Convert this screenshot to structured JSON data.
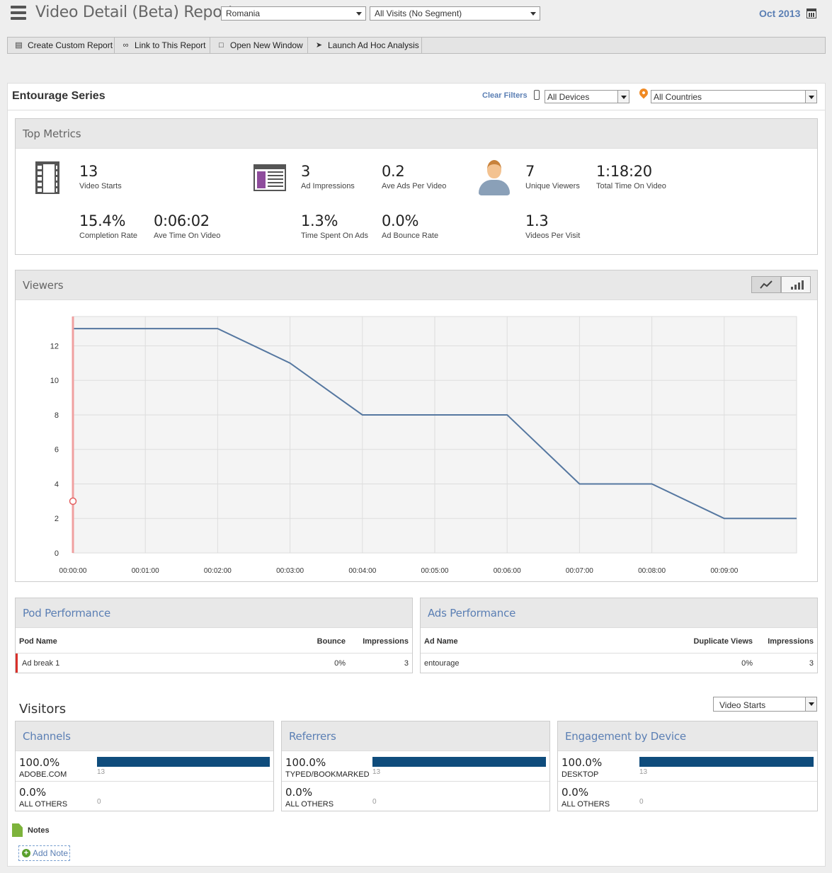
{
  "header": {
    "title": "Video Detail (Beta) Report",
    "region_select": "Romania",
    "segment_select": "All Visits (No Segment)",
    "date": "Oct 2013"
  },
  "toolbar": {
    "create_custom_report": "Create Custom Report",
    "link_report": "Link to This Report",
    "open_window": "Open New Window",
    "launch_adhoc": "Launch Ad Hoc Analysis"
  },
  "series": {
    "title": "Entourage Series",
    "clear_filters": "Clear Filters",
    "devices_select": "All Devices",
    "countries_select": "All Countries"
  },
  "top_metrics": {
    "title": "Top Metrics",
    "video_starts": {
      "value": "13",
      "label": "Video Starts"
    },
    "completion_rate": {
      "value": "15.4%",
      "label": "Completion Rate"
    },
    "ave_time_on_video": {
      "value": "0:06:02",
      "label": "Ave Time On Video"
    },
    "ad_impressions": {
      "value": "3",
      "label": "Ad Impressions"
    },
    "ave_ads_per_video": {
      "value": "0.2",
      "label": "Ave Ads Per Video"
    },
    "time_spent_on_ads": {
      "value": "1.3%",
      "label": "Time Spent On Ads"
    },
    "ad_bounce_rate": {
      "value": "0.0%",
      "label": "Ad Bounce Rate"
    },
    "unique_viewers": {
      "value": "7",
      "label": "Unique Viewers"
    },
    "total_time_on_video": {
      "value": "1:18:20",
      "label": "Total Time On Video"
    },
    "videos_per_visit": {
      "value": "1.3",
      "label": "Videos Per Visit"
    }
  },
  "viewers": {
    "title": "Viewers"
  },
  "chart_data": {
    "type": "line",
    "x": [
      "00:00:00",
      "00:01:00",
      "00:02:00",
      "00:03:00",
      "00:04:00",
      "00:05:00",
      "00:06:00",
      "00:07:00",
      "00:08:00",
      "00:09:00",
      "00:10:00"
    ],
    "xticks": [
      "00:00:00",
      "00:01:00",
      "00:02:00",
      "00:03:00",
      "00:04:00",
      "00:05:00",
      "00:06:00",
      "00:07:00",
      "00:08:00",
      "00:09:00"
    ],
    "series": [
      {
        "values": [
          13,
          13,
          13,
          11,
          8,
          8,
          8,
          4,
          4,
          2,
          2
        ],
        "color": "#5577a0"
      }
    ],
    "yticks": [
      0,
      2,
      4,
      6,
      8,
      10,
      12
    ],
    "ylim": [
      0,
      13.7
    ],
    "grid": true,
    "marker": {
      "x": "00:00:00",
      "y": 3,
      "color": "#e36060"
    }
  },
  "pod_performance": {
    "title": "Pod Performance",
    "columns": [
      "Pod Name",
      "Bounce",
      "Impressions"
    ],
    "rows": [
      {
        "name": "Ad break 1",
        "bounce": "0%",
        "impressions": "3"
      }
    ]
  },
  "ads_performance": {
    "title": "Ads Performance",
    "columns": [
      "Ad Name",
      "Duplicate Views",
      "Impressions"
    ],
    "rows": [
      {
        "name": "entourage",
        "duplicate_views": "0%",
        "impressions": "3"
      }
    ]
  },
  "visitors": {
    "title": "Visitors",
    "metric_select": "Video Starts",
    "channels": {
      "title": "Channels",
      "rows": [
        {
          "pct": "100.0%",
          "label": "ADOBE.COM",
          "count": "13",
          "share": 1.0
        },
        {
          "pct": "0.0%",
          "label": "ALL OTHERS",
          "count": "0",
          "share": 0.0
        }
      ]
    },
    "referrers": {
      "title": "Referrers",
      "rows": [
        {
          "pct": "100.0%",
          "label": "TYPED/BOOKMARKED",
          "count": "13",
          "share": 1.0
        },
        {
          "pct": "0.0%",
          "label": "ALL OTHERS",
          "count": "0",
          "share": 0.0
        }
      ]
    },
    "engagement": {
      "title": "Engagement by Device",
      "rows": [
        {
          "pct": "100.0%",
          "label": "DESKTOP",
          "count": "13",
          "share": 1.0
        },
        {
          "pct": "0.0%",
          "label": "ALL OTHERS",
          "count": "0",
          "share": 0.0
        }
      ]
    }
  },
  "notes": {
    "label": "Notes",
    "add_note": "Add Note"
  },
  "colors": {
    "accent": "#5b7fb4",
    "bar": "#0f4c7c",
    "line": "#5577a0",
    "marker": "#e36060"
  }
}
